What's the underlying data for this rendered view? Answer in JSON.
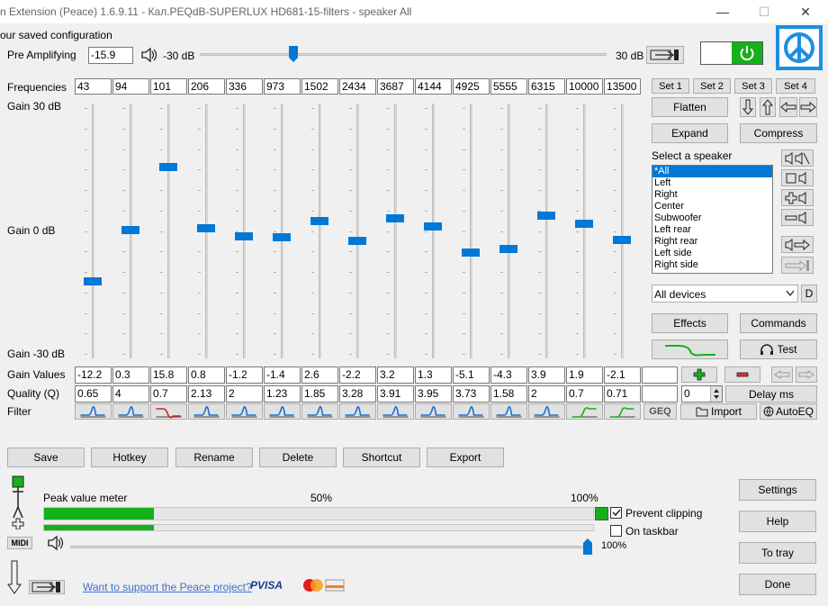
{
  "window": {
    "title": "n Extension (Peace) 1.6.9.11 - Кал.PEQdB-SUPERLUX HD681-15-filters - speaker All",
    "minimize_glyph": "—",
    "maximize_glyph": "☐",
    "close_glyph": "✕"
  },
  "header": {
    "saved_config_text": "our saved configuration",
    "pre_amp_label": "Pre Amplifying",
    "pre_amp_value": "-15.9",
    "pre_amp_min": "-30 dB",
    "pre_amp_max": "30 dB",
    "pre_amp_level_fraction": 0.23
  },
  "eq": {
    "frequencies_label": "Frequencies",
    "gain_top_label": "Gain 30 dB",
    "gain_mid_label": "Gain 0 dB",
    "gain_bottom_label": "Gain -30 dB",
    "gain_values_label": "Gain Values",
    "quality_label": "Quality (Q)",
    "filter_label": "Filter",
    "gain_range": [
      -30,
      30
    ],
    "frequencies": [
      "43",
      "94",
      "101",
      "206",
      "336",
      "973",
      "1502",
      "2434",
      "3687",
      "4144",
      "4925",
      "5555",
      "6315",
      "10000",
      "13500"
    ],
    "gains": [
      "-12.2",
      "0.3",
      "15.8",
      "0.8",
      "-1.2",
      "-1.4",
      "2.6",
      "-2.2",
      "3.2",
      "1.3",
      "-5.1",
      "-4.3",
      "3.9",
      "1.9",
      "-2.1"
    ],
    "gain_numbers": [
      -12.2,
      0.3,
      15.8,
      0.8,
      -1.2,
      -1.4,
      2.6,
      -2.2,
      3.2,
      1.3,
      -5.1,
      -4.3,
      3.9,
      1.9,
      -2.1
    ],
    "qualities": [
      "0.65",
      "4",
      "0.7",
      "2.13",
      "2",
      "1.23",
      "1.85",
      "3.28",
      "3.91",
      "3.95",
      "3.73",
      "1.58",
      "2",
      "0.7",
      "0.71"
    ],
    "filters": [
      "peak",
      "peak",
      "low-shelf",
      "peak",
      "peak",
      "peak",
      "peak",
      "peak",
      "peak",
      "peak",
      "peak",
      "peak",
      "peak",
      "high-shelf",
      "high-shelf"
    ],
    "delay_value": "0"
  },
  "sets": [
    "Set 1",
    "Set 2",
    "Set 3",
    "Set 4"
  ],
  "right_panel": {
    "flatten": "Flatten",
    "expand": "Expand",
    "compress": "Compress",
    "select_speaker_label": "Select a speaker",
    "speakers": [
      "*All",
      "Left",
      "Right",
      "Center",
      "Subwoofer",
      "Left rear",
      "Right rear",
      "Left side",
      "Right side"
    ],
    "selected_speaker": "*All",
    "device": "All devices",
    "d_button": "D",
    "effects": "Effects",
    "commands": "Commands",
    "test": "Test",
    "delay_ms": "Delay ms",
    "geq": "GEQ",
    "import": "Import",
    "autoeq": "AutoEQ"
  },
  "actions": [
    "Save",
    "Hotkey",
    "Rename",
    "Delete",
    "Shortcut",
    "Export"
  ],
  "meter": {
    "title": "Peak value meter",
    "mid_label": "50%",
    "max_label": "100%",
    "level_fraction": 0.2,
    "prevent_clipping": "Prevent clipping",
    "prevent_clipping_checked": true,
    "on_taskbar": "On taskbar",
    "on_taskbar_checked": false,
    "midi": "MIDI",
    "volume_label": "100%",
    "volume_fraction": 1.0
  },
  "footer": {
    "support_link": "Want to support the Peace project?",
    "payment_text": "PVISA"
  },
  "side_buttons": {
    "settings": "Settings",
    "help": "Help",
    "to_tray": "To tray",
    "done": "Done"
  },
  "colors": {
    "accent": "#0078d7",
    "power_green": "#16b01b",
    "meter_green": "#16b01b",
    "logo_blue": "#1d8fe0",
    "link": "#3b6fd6"
  }
}
